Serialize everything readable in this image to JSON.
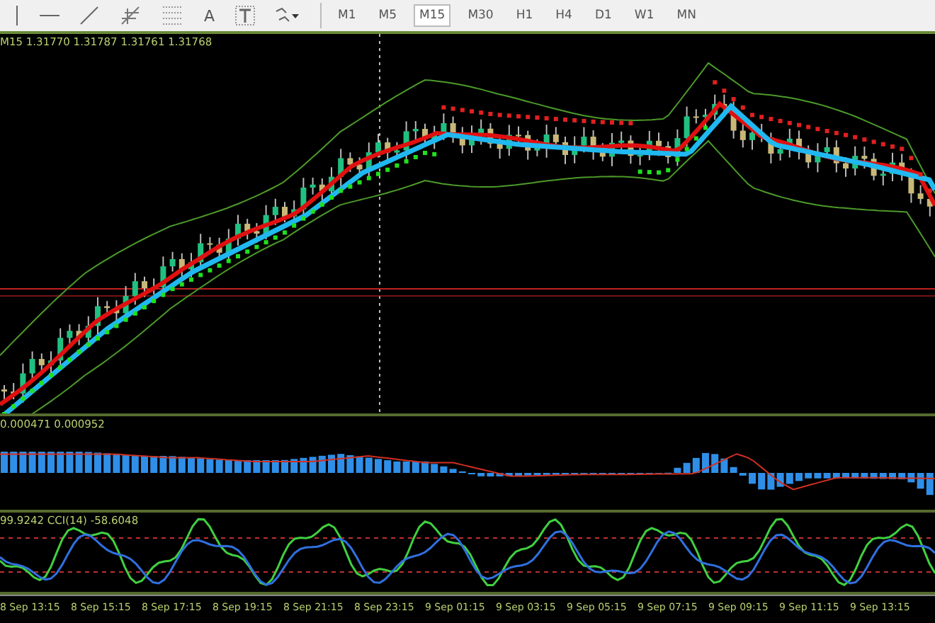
{
  "toolbar": {
    "tools": [
      {
        "kind": "vline"
      },
      {
        "kind": "hline"
      },
      {
        "kind": "trend"
      },
      {
        "kind": "fibo"
      },
      {
        "kind": "grid"
      },
      {
        "kind": "text",
        "label": "A"
      },
      {
        "kind": "label"
      },
      {
        "kind": "shapes"
      }
    ],
    "periods": [
      {
        "label": "M1",
        "selected": false
      },
      {
        "label": "M5",
        "selected": false
      },
      {
        "label": "M15",
        "selected": true
      },
      {
        "label": "M30",
        "selected": false
      },
      {
        "label": "H1",
        "selected": false
      },
      {
        "label": "H4",
        "selected": false
      },
      {
        "label": "D1",
        "selected": false
      },
      {
        "label": "W1",
        "selected": false
      },
      {
        "label": "MN",
        "selected": false
      }
    ]
  },
  "main_pane": {
    "info": "M15  1.31770 1.31787 1.31761 1.31768"
  },
  "macd_pane": {
    "label": "0.000471 0.000952"
  },
  "cci_pane": {
    "label": "99.9242  CCI(14) -58.6048"
  },
  "time_axis": [
    "8 Sep 13:15",
    "8 Sep 15:15",
    "8 Sep 17:15",
    "8 Sep 19:15",
    "8 Sep 21:15",
    "8 Sep 23:15",
    "9 Sep 01:15",
    "9 Sep 03:15",
    "9 Sep 05:15",
    "9 Sep 07:15",
    "9 Sep 09:15",
    "9 Sep 11:15",
    "9 Sep 13:15"
  ]
}
